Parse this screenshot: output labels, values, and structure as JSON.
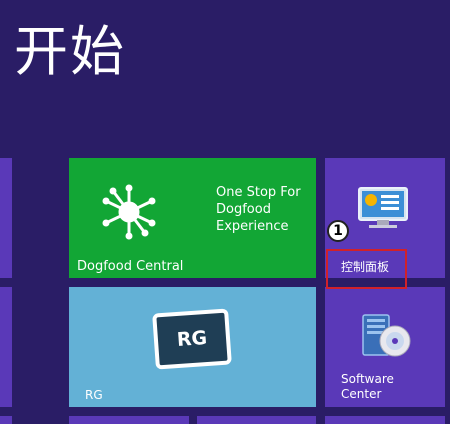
{
  "screen": {
    "title": "开始"
  },
  "tiles": {
    "dogfood": {
      "label": "Dogfood Central",
      "description": "One Stop For Dogfood Experience",
      "icon": "network-hub-icon",
      "color": "#12a635"
    },
    "control_panel": {
      "label": "控制面板",
      "icon": "control-panel-icon",
      "color": "#5a39b8"
    },
    "rg": {
      "label": "RG",
      "badge": "RG",
      "icon": "rg-tablet-icon",
      "color": "#63b1d6"
    },
    "software_center": {
      "label": "Software Center",
      "icon": "software-center-icon",
      "color": "#5a39b8"
    }
  },
  "annotation": {
    "step_number": "1",
    "box_color": "#d0212a"
  },
  "background_color": "#2a1d66"
}
